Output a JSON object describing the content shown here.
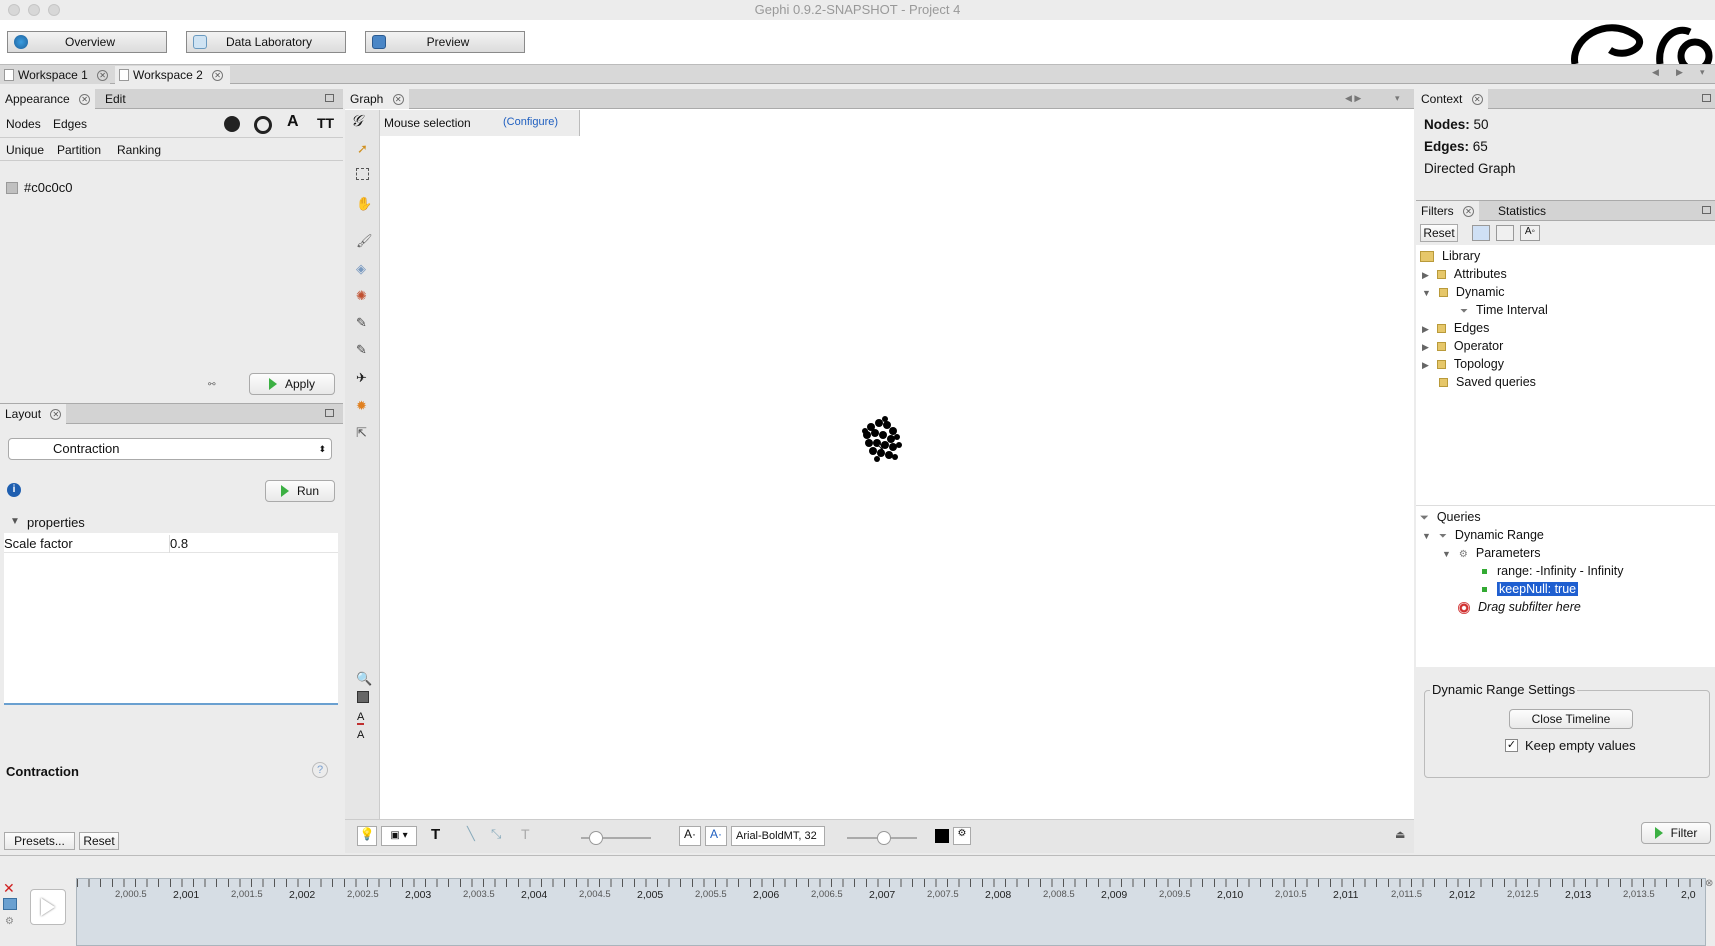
{
  "window": {
    "title": "Gephi 0.9.2-SNAPSHOT - Project 4"
  },
  "modes": [
    {
      "label": "Overview",
      "icon": "globe-icon"
    },
    {
      "label": "Data Laboratory",
      "icon": "table-icon"
    },
    {
      "label": "Preview",
      "icon": "monitor-icon"
    }
  ],
  "workspaces": [
    {
      "label": "Workspace 1"
    },
    {
      "label": "Workspace 2"
    }
  ],
  "appearance": {
    "tab_label": "Appearance",
    "edit_tab_label": "Edit",
    "target_tabs": [
      "Nodes",
      "Edges"
    ],
    "mode_tabs": [
      "Unique",
      "Partition",
      "Ranking"
    ],
    "color_value": "#c0c0c0",
    "apply_label": "Apply"
  },
  "layout": {
    "tab_label": "Layout",
    "algorithm": "Contraction",
    "run_label": "Run",
    "properties_label": "properties",
    "property_name": "Scale factor",
    "property_value": "0.8",
    "description_title": "Contraction",
    "presets_label": "Presets...",
    "reset_label": "Reset"
  },
  "graph": {
    "tab_label": "Graph",
    "mouse_selection": "Mouse selection",
    "configure_link": "(Configure)",
    "font_label": "Arial-BoldMT, 32",
    "node_color": "#000000"
  },
  "context": {
    "tab_label": "Context",
    "nodes_label": "Nodes:",
    "nodes_value": "50",
    "edges_label": "Edges:",
    "edges_value": "65",
    "graph_type": "Directed Graph"
  },
  "filters": {
    "tab_label": "Filters",
    "statistics_tab_label": "Statistics",
    "reset_label": "Reset",
    "library_label": "Library",
    "library_items": [
      {
        "label": "Attributes",
        "expanded": false
      },
      {
        "label": "Dynamic",
        "expanded": true
      },
      {
        "label": "Time Interval",
        "child": true
      },
      {
        "label": "Edges",
        "expanded": false
      },
      {
        "label": "Operator",
        "expanded": false
      },
      {
        "label": "Topology",
        "expanded": false
      },
      {
        "label": "Saved queries",
        "leaf": true
      }
    ],
    "queries_label": "Queries",
    "query_name": "Dynamic Range",
    "parameters_label": "Parameters",
    "param_range": "range: -Infinity - Infinity",
    "param_keepnull": "keepNull: true",
    "drag_subfilter": "Drag subfilter here",
    "settings_title": "Dynamic Range Settings",
    "close_timeline_label": "Close Timeline",
    "keep_empty_label": "Keep empty values",
    "keep_empty_checked": true,
    "filter_button_label": "Filter"
  },
  "timeline": {
    "ticks": [
      "2,000.5",
      "2,001",
      "2,001.5",
      "2,002",
      "2,002.5",
      "2,003",
      "2,003.5",
      "2,004",
      "2,004.5",
      "2,005",
      "2,005.5",
      "2,006",
      "2,006.5",
      "2,007",
      "2,007.5",
      "2,008",
      "2,008.5",
      "2,009",
      "2,009.5",
      "2,010",
      "2,010.5",
      "2,011",
      "2,011.5",
      "2,012",
      "2,012.5",
      "2,013",
      "2,013.5",
      "2,0"
    ]
  }
}
